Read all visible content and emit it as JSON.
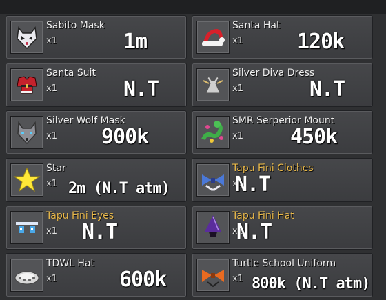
{
  "items": [
    {
      "name": "Sabito Mask",
      "qty": "x1",
      "price": "1m",
      "icon": "fox-mask-icon",
      "gold": false
    },
    {
      "name": "Santa Hat",
      "qty": "x1",
      "price": "120k",
      "icon": "santa-hat-icon",
      "gold": false
    },
    {
      "name": "Santa Suit",
      "qty": "x1",
      "price": "N.T",
      "icon": "santa-suit-icon",
      "gold": false
    },
    {
      "name": "Silver Diva Dress",
      "qty": "x1",
      "price": "N.T",
      "icon": "dress-icon",
      "gold": false
    },
    {
      "name": "Silver Wolf Mask",
      "qty": "x1",
      "price": "900k",
      "icon": "wolf-mask-icon",
      "gold": false
    },
    {
      "name": "SMR Serperior Mount",
      "qty": "x1",
      "price": "450k",
      "icon": "serpent-mount-icon",
      "gold": false
    },
    {
      "name": "Star",
      "qty": "x1",
      "price": "2m (N.T atm)",
      "icon": "star-icon",
      "gold": false
    },
    {
      "name": "Tapu Fini Clothes",
      "qty": "x1",
      "price": "N.T",
      "icon": "bow-clothes-icon",
      "gold": true
    },
    {
      "name": "Tapu Fini Eyes",
      "qty": "x1",
      "price": "N.T",
      "icon": "eyes-icon",
      "gold": true
    },
    {
      "name": "Tapu Fini Hat",
      "qty": "x1",
      "price": "N.T",
      "icon": "witch-hat-icon",
      "gold": true
    },
    {
      "name": "TDWL Hat",
      "qty": "x1",
      "price": "600k",
      "icon": "crown-hat-icon",
      "gold": false
    },
    {
      "name": "Turtle School Uniform",
      "qty": "x1",
      "price": "800k (N.T atm)",
      "icon": "uniform-icon",
      "gold": false
    }
  ]
}
